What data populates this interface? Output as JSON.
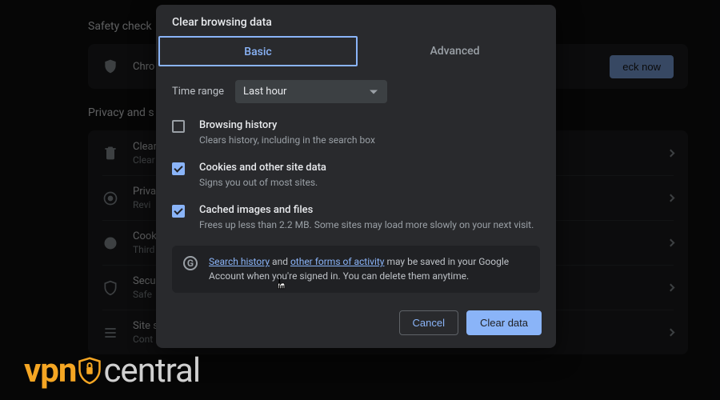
{
  "bg": {
    "safety_title": "Safety check",
    "safety_row_label": "Chro",
    "check_now": "eck now",
    "privacy_title": "Privacy and s",
    "rows": [
      {
        "t1": "Clear",
        "t2": "Clear"
      },
      {
        "t1": "Priva",
        "t2": "Revi"
      },
      {
        "t1": "Cook",
        "t2": "Third"
      },
      {
        "t1": "Secu",
        "t2": "Safe"
      },
      {
        "t1": "Site s",
        "t2": "Cont"
      }
    ]
  },
  "modal": {
    "title": "Clear browsing data",
    "tabs": {
      "basic": "Basic",
      "advanced": "Advanced"
    },
    "time_label": "Time range",
    "time_value": "Last hour",
    "items": [
      {
        "checked": false,
        "title": "Browsing history",
        "desc": "Clears history, including in the search box"
      },
      {
        "checked": true,
        "title": "Cookies and other site data",
        "desc": "Signs you out of most sites."
      },
      {
        "checked": true,
        "title": "Cached images and files",
        "desc": "Frees up less than 2.2 MB. Some sites may load more slowly on your next visit."
      }
    ],
    "info": {
      "link1": "Search history",
      "mid1": " and ",
      "link2": "other forms of activity",
      "tail": " may be saved in your Google Account when you're signed in. You can delete them anytime."
    },
    "cancel": "Cancel",
    "clear": "Clear data"
  },
  "watermark": {
    "a": "vpn",
    "b": "central"
  }
}
